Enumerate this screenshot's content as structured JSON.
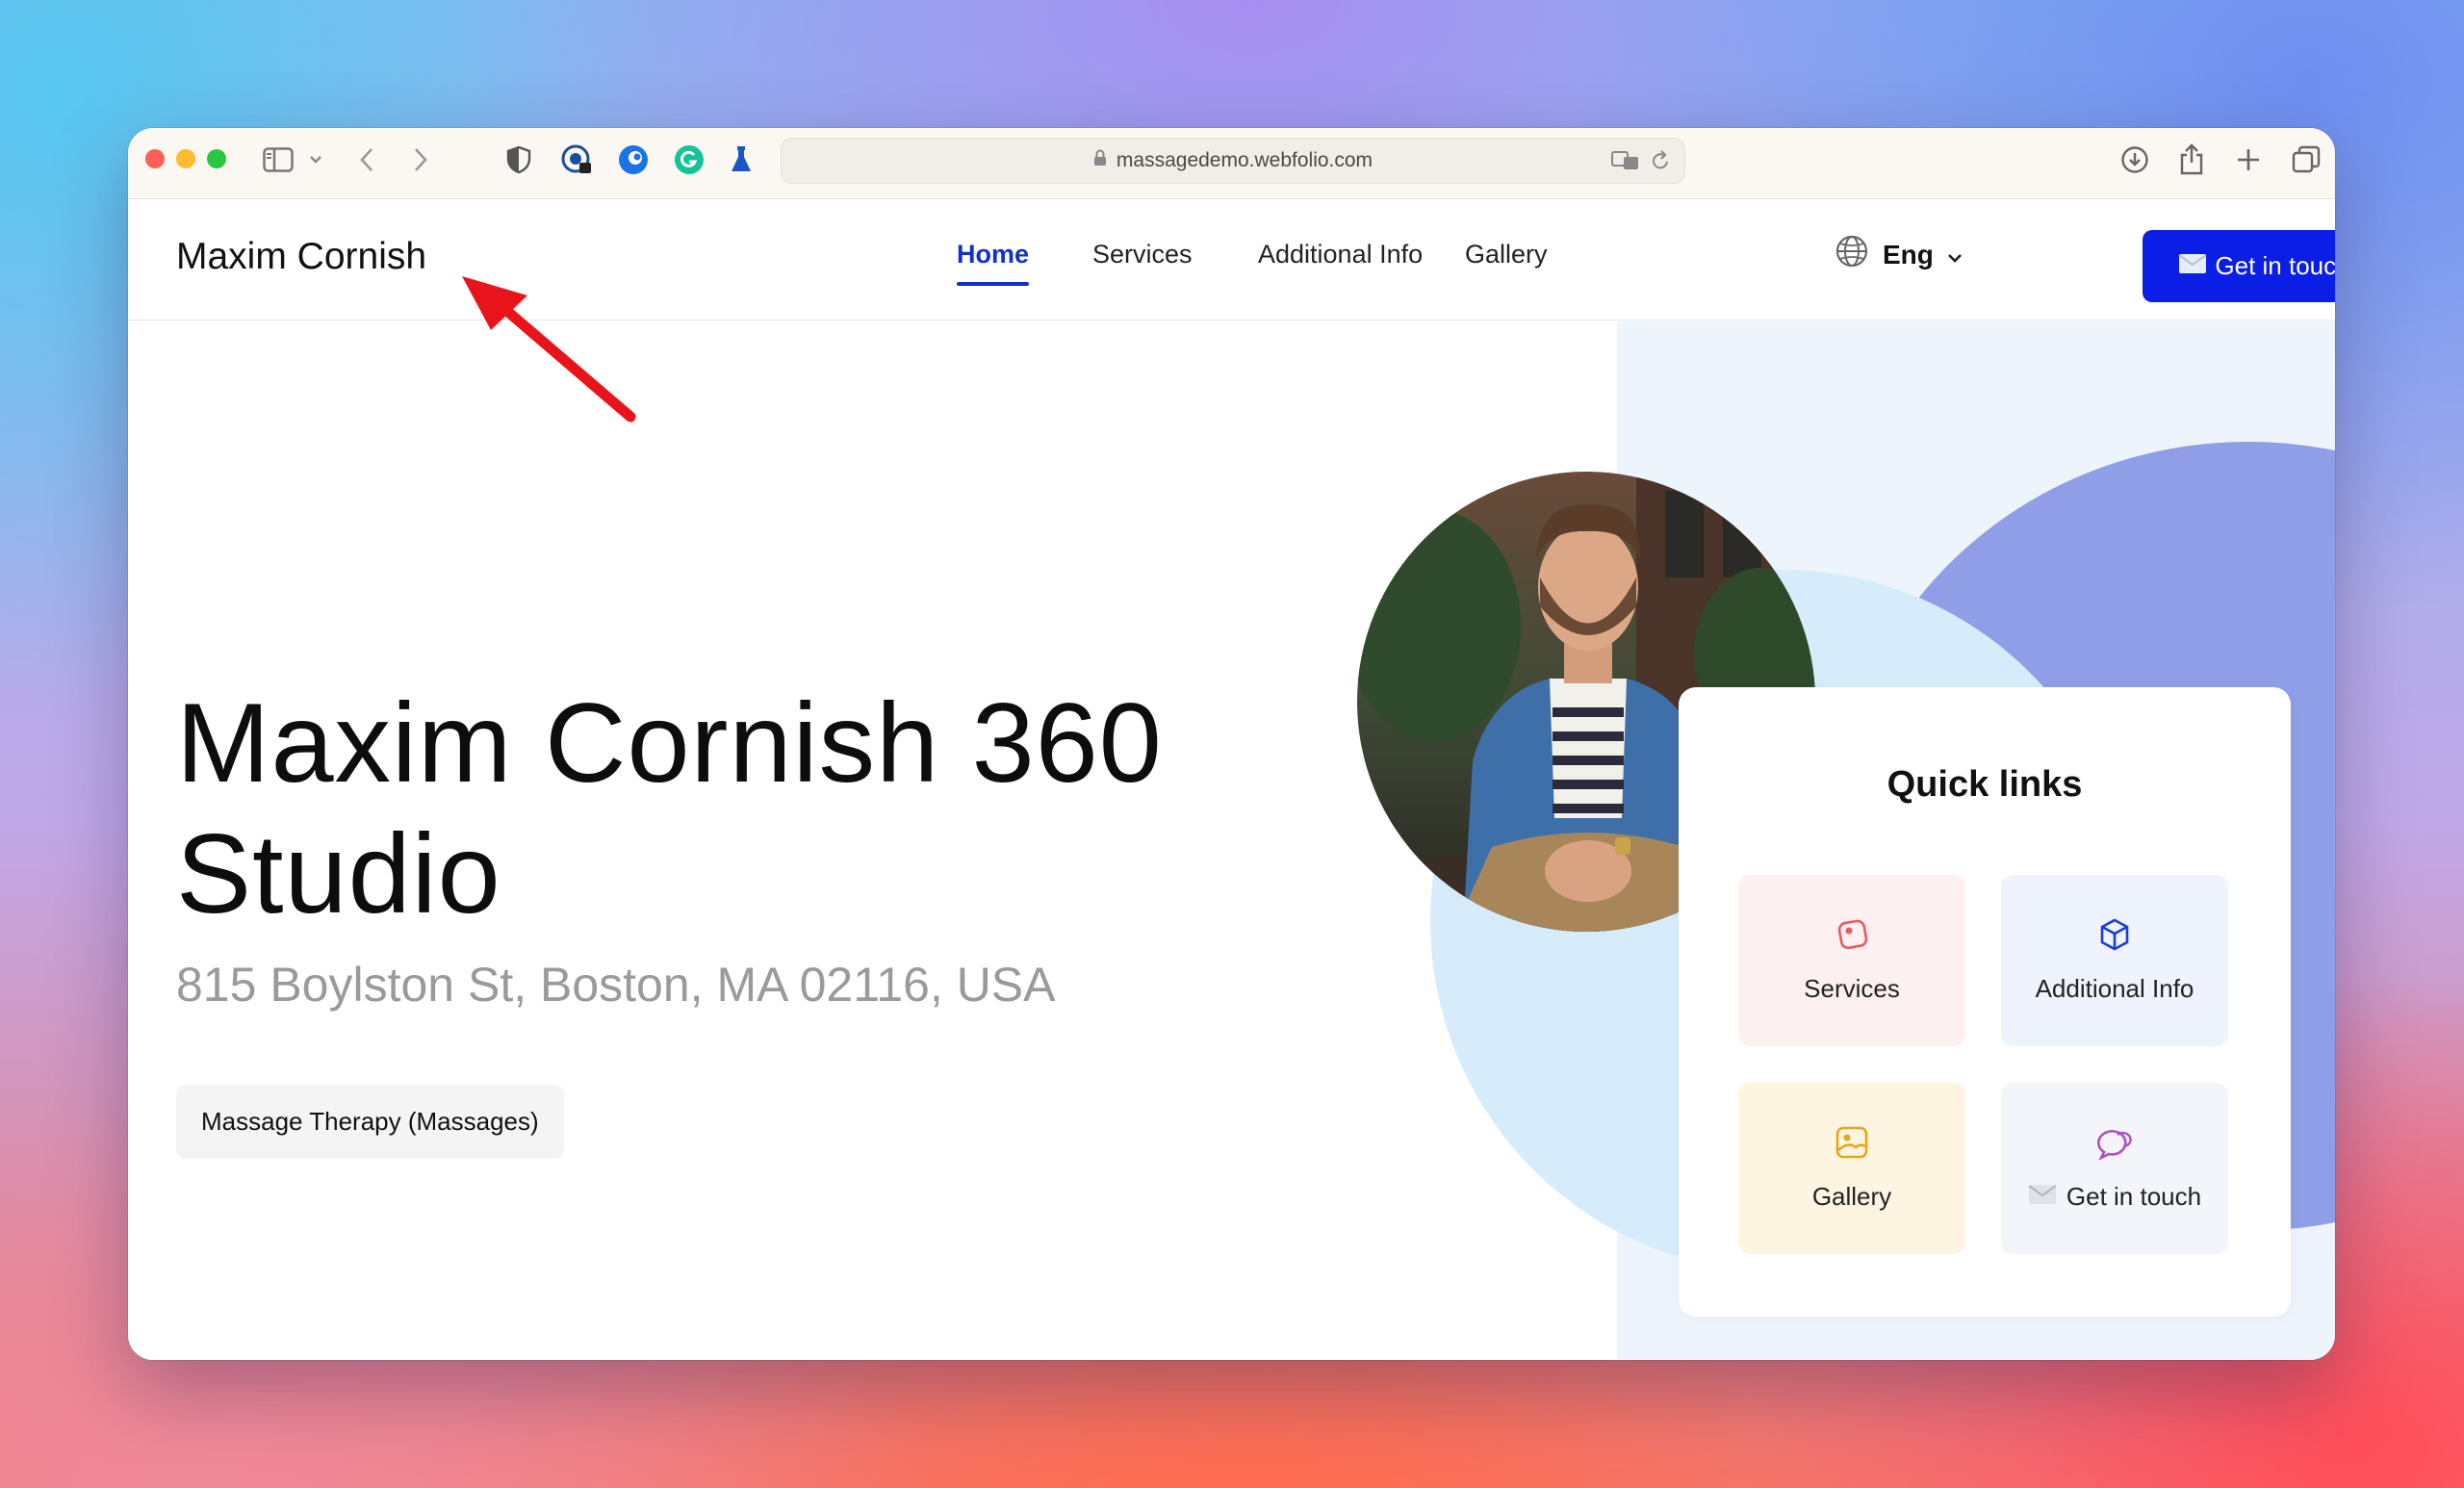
{
  "browser": {
    "url": "massagedemo.webfolio.com",
    "icons": [
      "sidebar-icon",
      "chevron-down-icon",
      "back-icon",
      "forward-icon",
      "shield-icon",
      "password-icon",
      "extension-icon",
      "grammarly-icon",
      "flask-icon",
      "translate-icon",
      "reload-icon",
      "download-icon",
      "share-icon",
      "new-tab-icon",
      "tabs-overview-icon"
    ]
  },
  "header": {
    "brand": "Maxim Cornish",
    "nav": [
      {
        "label": "Home",
        "active": true
      },
      {
        "label": "Services",
        "active": false
      },
      {
        "label": "Additional Info",
        "active": false
      },
      {
        "label": "Gallery",
        "active": false
      }
    ],
    "language": "Eng",
    "cta_label": "Get in touch"
  },
  "hero": {
    "title_line1": "Maxim Cornish 360",
    "title_line2": "Studio",
    "address": "815 Boylston St, Boston, MA 02116, USA",
    "tag": "Massage Therapy (Massages)"
  },
  "quick_links": {
    "title": "Quick links",
    "items": [
      {
        "label": "Services",
        "icon": "services-icon"
      },
      {
        "label": "Additional Info",
        "icon": "cube-icon"
      },
      {
        "label": "Gallery",
        "icon": "gallery-icon"
      },
      {
        "label": "Get in touch",
        "icon": "chat-icon"
      }
    ]
  },
  "colors": {
    "accent": "#0a1ee6",
    "nav_active": "#1330c8",
    "annotation_arrow": "#e8141a"
  }
}
